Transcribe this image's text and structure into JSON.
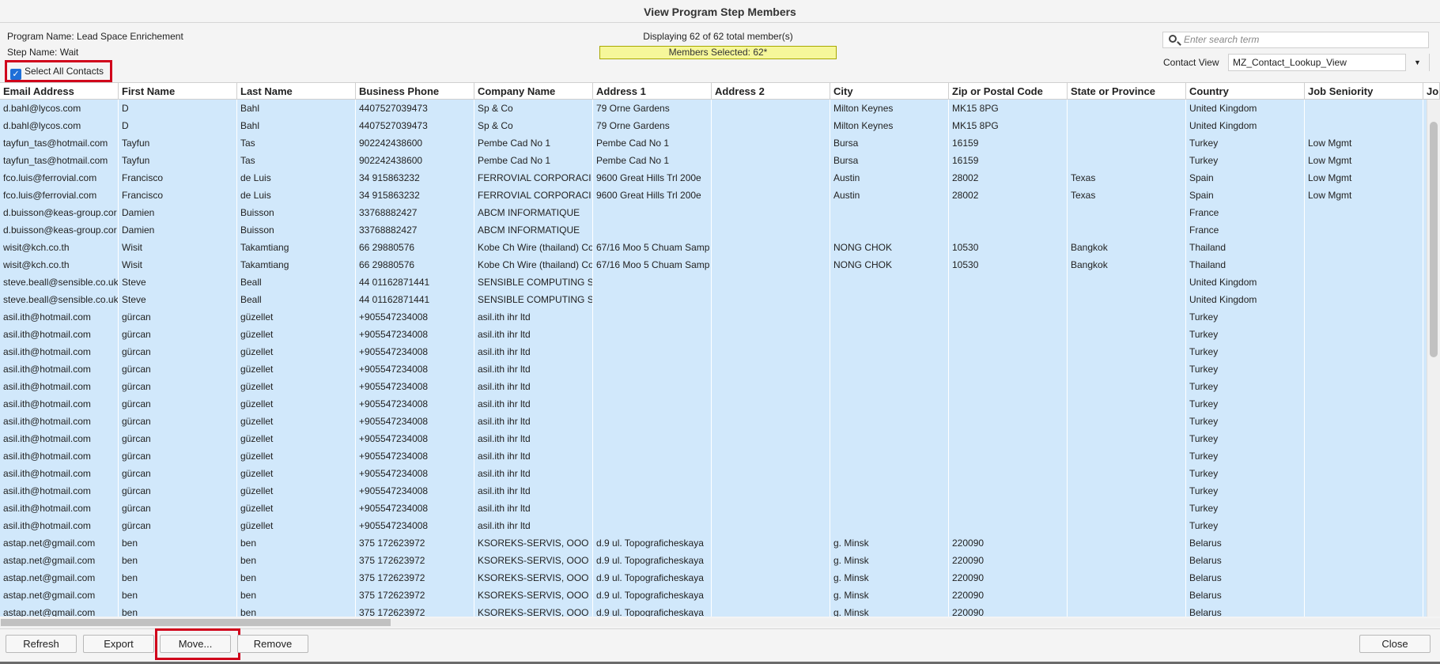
{
  "dialog": {
    "title": "View Program Step Members"
  },
  "info": {
    "program_name": "Program Name: Lead Space Enrichement",
    "step_name": "Step Name: Wait",
    "displaying": "Displaying 62 of 62 total member(s)",
    "members_selected": "Members Selected: 62*",
    "select_all_label": "Select All Contacts"
  },
  "search": {
    "placeholder": "Enter search term"
  },
  "contact_view": {
    "label": "Contact View",
    "value": "MZ_Contact_Lookup_View"
  },
  "columns": [
    "Email Address",
    "First Name",
    "Last Name",
    "Business Phone",
    "Company Name",
    "Address 1",
    "Address 2",
    "City",
    "Zip or Postal Code",
    "State or Province",
    "Country",
    "Job Seniority",
    "Jo"
  ],
  "rows": [
    [
      "d.bahl@lycos.com",
      "D",
      "Bahl",
      "4407527039473",
      "Sp & Co",
      "79 Orne Gardens",
      "",
      "Milton Keynes",
      "MK15 8PG",
      "",
      "United Kingdom",
      ""
    ],
    [
      "d.bahl@lycos.com",
      "D",
      "Bahl",
      "4407527039473",
      "Sp & Co",
      "79 Orne Gardens",
      "",
      "Milton Keynes",
      "MK15 8PG",
      "",
      "United Kingdom",
      ""
    ],
    [
      "tayfun_tas@hotmail.com",
      "Tayfun",
      "Tas",
      "902242438600",
      "Pembe Cad No 1",
      "Pembe Cad No 1",
      "",
      "Bursa",
      "16159",
      "",
      "Turkey",
      "Low Mgmt"
    ],
    [
      "tayfun_tas@hotmail.com",
      "Tayfun",
      "Tas",
      "902242438600",
      "Pembe Cad No 1",
      "Pembe Cad No 1",
      "",
      "Bursa",
      "16159",
      "",
      "Turkey",
      "Low Mgmt"
    ],
    [
      "fco.luis@ferrovial.com",
      "Francisco",
      "de Luis",
      "34 915863232",
      "FERROVIAL CORPORACI",
      "9600 Great Hills Trl 200e",
      "",
      "Austin",
      "28002",
      "Texas",
      "Spain",
      "Low Mgmt"
    ],
    [
      "fco.luis@ferrovial.com",
      "Francisco",
      "de Luis",
      "34 915863232",
      "FERROVIAL CORPORACI",
      "9600 Great Hills Trl 200e",
      "",
      "Austin",
      "28002",
      "Texas",
      "Spain",
      "Low Mgmt"
    ],
    [
      "d.buisson@keas-group.cor",
      "Damien",
      "Buisson",
      "33768882427",
      "ABCM INFORMATIQUE",
      "",
      "",
      "",
      "",
      "",
      "France",
      ""
    ],
    [
      "d.buisson@keas-group.cor",
      "Damien",
      "Buisson",
      "33768882427",
      "ABCM INFORMATIQUE",
      "",
      "",
      "",
      "",
      "",
      "France",
      ""
    ],
    [
      "wisit@kch.co.th",
      "Wisit",
      "Takamtiang",
      "66 29880576",
      "Kobe Ch Wire (thailand) Co",
      "67/16 Moo 5 Chuam Samp",
      "",
      "NONG CHOK",
      "10530",
      "Bangkok",
      "Thailand",
      ""
    ],
    [
      "wisit@kch.co.th",
      "Wisit",
      "Takamtiang",
      "66 29880576",
      "Kobe Ch Wire (thailand) Co",
      "67/16 Moo 5 Chuam Samp",
      "",
      "NONG CHOK",
      "10530",
      "Bangkok",
      "Thailand",
      ""
    ],
    [
      "steve.beall@sensible.co.uk",
      "Steve",
      "Beall",
      "44 01162871441",
      "SENSIBLE COMPUTING S",
      "",
      "",
      "",
      "",
      "",
      "United Kingdom",
      ""
    ],
    [
      "steve.beall@sensible.co.uk",
      "Steve",
      "Beall",
      "44 01162871441",
      "SENSIBLE COMPUTING S",
      "",
      "",
      "",
      "",
      "",
      "United Kingdom",
      ""
    ],
    [
      "asil.ith@hotmail.com",
      "gürcan",
      "güzellet",
      "+905547234008",
      "asil.ith ihr ltd",
      "",
      "",
      "",
      "",
      "",
      "Turkey",
      ""
    ],
    [
      "asil.ith@hotmail.com",
      "gürcan",
      "güzellet",
      "+905547234008",
      "asil.ith ihr ltd",
      "",
      "",
      "",
      "",
      "",
      "Turkey",
      ""
    ],
    [
      "asil.ith@hotmail.com",
      "gürcan",
      "güzellet",
      "+905547234008",
      "asil.ith ihr ltd",
      "",
      "",
      "",
      "",
      "",
      "Turkey",
      ""
    ],
    [
      "asil.ith@hotmail.com",
      "gürcan",
      "güzellet",
      "+905547234008",
      "asil.ith ihr ltd",
      "",
      "",
      "",
      "",
      "",
      "Turkey",
      ""
    ],
    [
      "asil.ith@hotmail.com",
      "gürcan",
      "güzellet",
      "+905547234008",
      "asil.ith ihr ltd",
      "",
      "",
      "",
      "",
      "",
      "Turkey",
      ""
    ],
    [
      "asil.ith@hotmail.com",
      "gürcan",
      "güzellet",
      "+905547234008",
      "asil.ith ihr ltd",
      "",
      "",
      "",
      "",
      "",
      "Turkey",
      ""
    ],
    [
      "asil.ith@hotmail.com",
      "gürcan",
      "güzellet",
      "+905547234008",
      "asil.ith ihr ltd",
      "",
      "",
      "",
      "",
      "",
      "Turkey",
      ""
    ],
    [
      "asil.ith@hotmail.com",
      "gürcan",
      "güzellet",
      "+905547234008",
      "asil.ith ihr ltd",
      "",
      "",
      "",
      "",
      "",
      "Turkey",
      ""
    ],
    [
      "asil.ith@hotmail.com",
      "gürcan",
      "güzellet",
      "+905547234008",
      "asil.ith ihr ltd",
      "",
      "",
      "",
      "",
      "",
      "Turkey",
      ""
    ],
    [
      "asil.ith@hotmail.com",
      "gürcan",
      "güzellet",
      "+905547234008",
      "asil.ith ihr ltd",
      "",
      "",
      "",
      "",
      "",
      "Turkey",
      ""
    ],
    [
      "asil.ith@hotmail.com",
      "gürcan",
      "güzellet",
      "+905547234008",
      "asil.ith ihr ltd",
      "",
      "",
      "",
      "",
      "",
      "Turkey",
      ""
    ],
    [
      "asil.ith@hotmail.com",
      "gürcan",
      "güzellet",
      "+905547234008",
      "asil.ith ihr ltd",
      "",
      "",
      "",
      "",
      "",
      "Turkey",
      ""
    ],
    [
      "asil.ith@hotmail.com",
      "gürcan",
      "güzellet",
      "+905547234008",
      "asil.ith ihr ltd",
      "",
      "",
      "",
      "",
      "",
      "Turkey",
      ""
    ],
    [
      "astap.net@gmail.com",
      "ben",
      "ben",
      "375 172623972",
      "KSOREKS-SERVIS, OOO",
      "d.9 ul. Topograficheskaya",
      "",
      "g. Minsk",
      "220090",
      "",
      "Belarus",
      ""
    ],
    [
      "astap.net@gmail.com",
      "ben",
      "ben",
      "375 172623972",
      "KSOREKS-SERVIS, OOO",
      "d.9 ul. Topograficheskaya",
      "",
      "g. Minsk",
      "220090",
      "",
      "Belarus",
      ""
    ],
    [
      "astap.net@gmail.com",
      "ben",
      "ben",
      "375 172623972",
      "KSOREKS-SERVIS, OOO",
      "d.9 ul. Topograficheskaya",
      "",
      "g. Minsk",
      "220090",
      "",
      "Belarus",
      ""
    ],
    [
      "astap.net@gmail.com",
      "ben",
      "ben",
      "375 172623972",
      "KSOREKS-SERVIS, OOO",
      "d.9 ul. Topograficheskaya",
      "",
      "g. Minsk",
      "220090",
      "",
      "Belarus",
      ""
    ],
    [
      "astap.net@gmail.com",
      "ben",
      "ben",
      "375 172623972",
      "KSOREKS-SERVIS, OOO",
      "d.9 ul. Topograficheskaya",
      "",
      "g. Minsk",
      "220090",
      "",
      "Belarus",
      ""
    ]
  ],
  "buttons": {
    "refresh": "Refresh",
    "export": "Export",
    "move": "Move...",
    "remove": "Remove",
    "close": "Close"
  },
  "colors": {
    "row_selected": "#d1e8fb",
    "highlight": "#d0021b",
    "selection_bar": "#f6f79a",
    "checkbox": "#1e6fd8"
  }
}
